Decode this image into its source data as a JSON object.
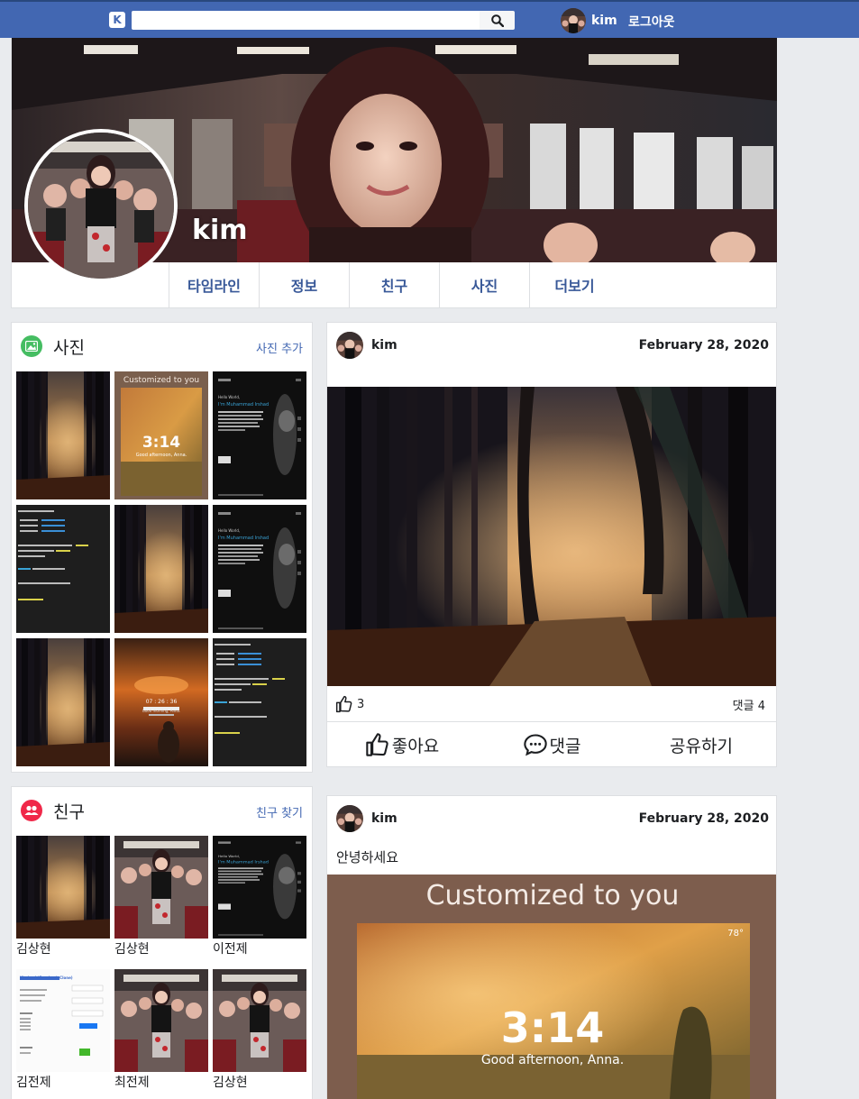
{
  "topbar": {
    "logo_letter": "K",
    "search_value": "",
    "username": "kim",
    "logout_label": "로그아웃"
  },
  "profile": {
    "name": "kim",
    "tabs": [
      "타임라인",
      "정보",
      "친구",
      "사진",
      "더보기"
    ]
  },
  "photos_panel": {
    "title": "사진",
    "action_label": "사진 추가"
  },
  "friends_panel": {
    "title": "친구",
    "action_label": "친구 찾기",
    "friends": [
      "김상현",
      "김상현",
      "이전제",
      "김전제",
      "최전제",
      "김상현"
    ]
  },
  "posts": [
    {
      "author": "kim",
      "date": "February 28, 2020",
      "text": "",
      "likes": "3",
      "comments": "댓글 4"
    },
    {
      "author": "kim",
      "date": "February 28, 2020",
      "text": "안녕하세요",
      "image_title": "Customized to you",
      "image_time": "3:14",
      "image_greeting": "Good afternoon, Anna.",
      "image_weather": "78°"
    }
  ],
  "post_actions": {
    "like": "좋아요",
    "comment": "댓글",
    "share": "공유하기"
  },
  "thumb_texts": {
    "lock_title": "Customized to you",
    "lock_time": "3:14",
    "lock_greeting": "Good afternoon, Anna.",
    "sunset_time": "07 : 26 : 36",
    "sunset_greeting": "Good morning, Anna.",
    "page_title": "Hello World,",
    "page_name": "I'm Muhammad Irshad",
    "code_title": "Kimbook(Facebook Clone)"
  },
  "icons": {
    "logo": "kimbook-logo-icon",
    "search": "search-icon",
    "photos": "photo-icon",
    "friends": "friends-icon",
    "like": "thumbs-up-icon",
    "comment": "comment-bubble-icon"
  },
  "colors": {
    "brand": "#4267b2",
    "link": "#385898",
    "photo_icon_bg": "#45bd62",
    "friends_icon_bg": "#f02849"
  }
}
